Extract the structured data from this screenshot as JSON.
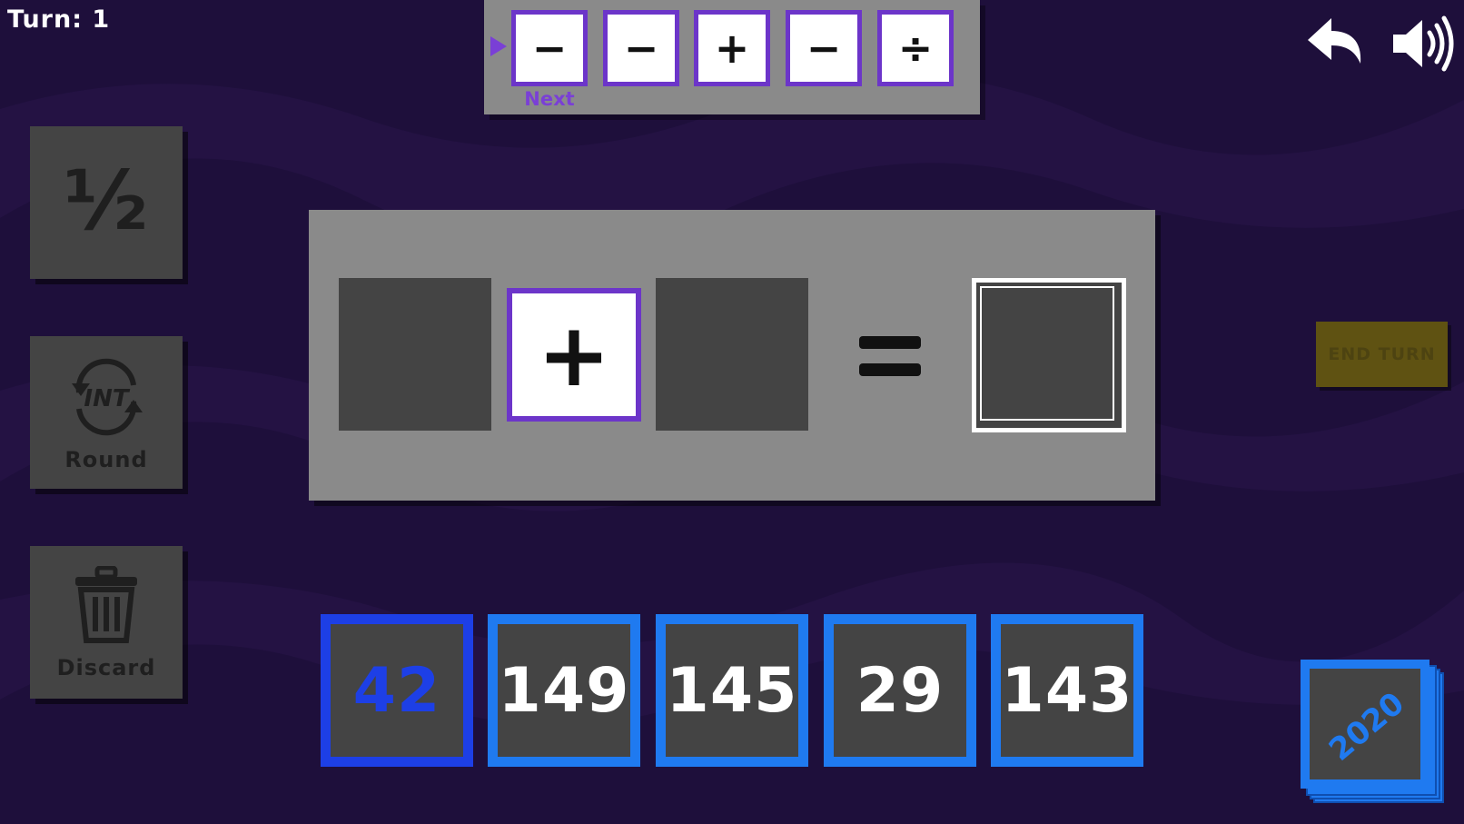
{
  "turn": {
    "label": "Turn: 1"
  },
  "operator_queue": {
    "next_label": "Next",
    "ops": [
      "−",
      "−",
      "+",
      "−",
      "÷"
    ]
  },
  "tools": {
    "half_label": "½",
    "round_label": "Round",
    "round_icon_text": "INT",
    "discard_label": "Discard"
  },
  "equation": {
    "operator": "+"
  },
  "end_turn": {
    "label": "END TURN"
  },
  "hand": {
    "cards": [
      "42",
      "149",
      "145",
      "29",
      "143"
    ],
    "selected_index": 0
  },
  "deck": {
    "label": "2020"
  },
  "colors": {
    "background": "#1e0f3b",
    "accent_purple": "#6c35c9",
    "card_blue": "#1f7af0",
    "selected_blue": "#1d3fe6",
    "end_turn_disabled": "#5f5212"
  },
  "icons": {
    "back": "undo-arrow-icon",
    "sound": "speaker-icon",
    "discard": "trash-icon",
    "round": "rotate-arrows-icon"
  }
}
